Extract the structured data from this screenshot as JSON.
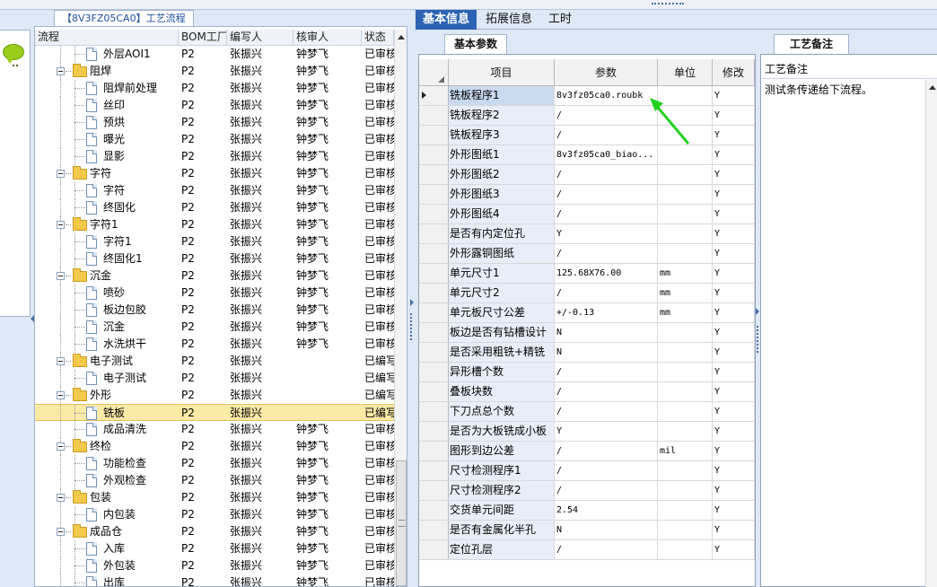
{
  "tree": {
    "tab_title": "【8V3FZ05CA0】工艺流程",
    "columns": [
      "流程",
      "BOM工厂",
      "编写人",
      "核审人",
      "状态"
    ],
    "rows": [
      {
        "label": "外层AOI1",
        "type": "doc",
        "level": 2,
        "bom": "P2",
        "writer": "张振兴",
        "reviewer": "钟梦飞",
        "status": "已审核"
      },
      {
        "label": "阻焊",
        "type": "folder",
        "level": 1,
        "bom": "P2",
        "writer": "张振兴",
        "reviewer": "钟梦飞",
        "status": "已审核"
      },
      {
        "label": "阻焊前处理",
        "type": "doc",
        "level": 2,
        "bom": "P2",
        "writer": "张振兴",
        "reviewer": "钟梦飞",
        "status": "已审核"
      },
      {
        "label": "丝印",
        "type": "doc",
        "level": 2,
        "bom": "P2",
        "writer": "张振兴",
        "reviewer": "钟梦飞",
        "status": "已审核"
      },
      {
        "label": "预烘",
        "type": "doc",
        "level": 2,
        "bom": "P2",
        "writer": "张振兴",
        "reviewer": "钟梦飞",
        "status": "已审核"
      },
      {
        "label": "曝光",
        "type": "doc",
        "level": 2,
        "bom": "P2",
        "writer": "张振兴",
        "reviewer": "钟梦飞",
        "status": "已审核"
      },
      {
        "label": "显影",
        "type": "doc",
        "level": 2,
        "bom": "P2",
        "writer": "张振兴",
        "reviewer": "钟梦飞",
        "status": "已审核"
      },
      {
        "label": "字符",
        "type": "folder",
        "level": 1,
        "bom": "P2",
        "writer": "张振兴",
        "reviewer": "钟梦飞",
        "status": "已审核"
      },
      {
        "label": "字符",
        "type": "doc",
        "level": 2,
        "bom": "P2",
        "writer": "张振兴",
        "reviewer": "钟梦飞",
        "status": "已审核"
      },
      {
        "label": "终固化",
        "type": "doc",
        "level": 2,
        "bom": "P2",
        "writer": "张振兴",
        "reviewer": "钟梦飞",
        "status": "已审核"
      },
      {
        "label": "字符1",
        "type": "folder",
        "level": 1,
        "bom": "P2",
        "writer": "张振兴",
        "reviewer": "钟梦飞",
        "status": "已审核"
      },
      {
        "label": "字符1",
        "type": "doc",
        "level": 2,
        "bom": "P2",
        "writer": "张振兴",
        "reviewer": "钟梦飞",
        "status": "已审核"
      },
      {
        "label": "终固化1",
        "type": "doc",
        "level": 2,
        "bom": "P2",
        "writer": "张振兴",
        "reviewer": "钟梦飞",
        "status": "已审核"
      },
      {
        "label": "沉金",
        "type": "folder",
        "level": 1,
        "bom": "P2",
        "writer": "张振兴",
        "reviewer": "钟梦飞",
        "status": "已审核"
      },
      {
        "label": "喷砂",
        "type": "doc",
        "level": 2,
        "bom": "P2",
        "writer": "张振兴",
        "reviewer": "钟梦飞",
        "status": "已审核"
      },
      {
        "label": "板边包胶",
        "type": "doc",
        "level": 2,
        "bom": "P2",
        "writer": "张振兴",
        "reviewer": "钟梦飞",
        "status": "已审核"
      },
      {
        "label": "沉金",
        "type": "doc",
        "level": 2,
        "bom": "P2",
        "writer": "张振兴",
        "reviewer": "钟梦飞",
        "status": "已审核"
      },
      {
        "label": "水洗烘干",
        "type": "doc",
        "level": 2,
        "bom": "P2",
        "writer": "张振兴",
        "reviewer": "钟梦飞",
        "status": "已审核"
      },
      {
        "label": "电子测试",
        "type": "folder",
        "level": 1,
        "bom": "P2",
        "writer": "张振兴",
        "reviewer": "",
        "status": "已编写"
      },
      {
        "label": "电子测试",
        "type": "doc",
        "level": 2,
        "bom": "P2",
        "writer": "张振兴",
        "reviewer": "",
        "status": "已编写"
      },
      {
        "label": "外形",
        "type": "folder",
        "level": 1,
        "bom": "P2",
        "writer": "张振兴",
        "reviewer": "",
        "status": "已编写"
      },
      {
        "label": "铣板",
        "type": "doc",
        "level": 2,
        "bom": "P2",
        "writer": "张振兴",
        "reviewer": "",
        "status": "已编写",
        "selected": true
      },
      {
        "label": "成品清洗",
        "type": "doc",
        "level": 2,
        "bom": "P2",
        "writer": "张振兴",
        "reviewer": "钟梦飞",
        "status": "已审核"
      },
      {
        "label": "终检",
        "type": "folder",
        "level": 1,
        "bom": "P2",
        "writer": "张振兴",
        "reviewer": "钟梦飞",
        "status": "已审核"
      },
      {
        "label": "功能检查",
        "type": "doc",
        "level": 2,
        "bom": "P2",
        "writer": "张振兴",
        "reviewer": "钟梦飞",
        "status": "已审核"
      },
      {
        "label": "外观检查",
        "type": "doc",
        "level": 2,
        "bom": "P2",
        "writer": "张振兴",
        "reviewer": "钟梦飞",
        "status": "已审核"
      },
      {
        "label": "包装",
        "type": "folder",
        "level": 1,
        "bom": "P2",
        "writer": "张振兴",
        "reviewer": "钟梦飞",
        "status": "已审核"
      },
      {
        "label": "内包装",
        "type": "doc",
        "level": 2,
        "bom": "P2",
        "writer": "张振兴",
        "reviewer": "钟梦飞",
        "status": "已审核"
      },
      {
        "label": "成品仓",
        "type": "folder",
        "level": 1,
        "bom": "P2",
        "writer": "张振兴",
        "reviewer": "钟梦飞",
        "status": "已审核"
      },
      {
        "label": "入库",
        "type": "doc",
        "level": 2,
        "bom": "P2",
        "writer": "张振兴",
        "reviewer": "钟梦飞",
        "status": "已审核"
      },
      {
        "label": "外包装",
        "type": "doc",
        "level": 2,
        "bom": "P2",
        "writer": "张振兴",
        "reviewer": "钟梦飞",
        "status": "已审核"
      },
      {
        "label": "出库",
        "type": "doc",
        "level": 2,
        "bom": "P2",
        "writer": "张振兴",
        "reviewer": "钟梦飞",
        "status": "已审核"
      }
    ]
  },
  "main_tabs": [
    {
      "label": "基本信息",
      "active": true
    },
    {
      "label": "拓展信息",
      "active": false
    },
    {
      "label": "工时",
      "active": false
    }
  ],
  "params": {
    "tab_label": "基本参数",
    "columns": [
      "项目",
      "参数",
      "单位",
      "修改"
    ],
    "rows": [
      {
        "item": "铣板程序1",
        "value": "8v3fz05ca0.roubk",
        "unit": "",
        "mod": "Y",
        "current": true
      },
      {
        "item": "铣板程序2",
        "value": "/",
        "unit": "",
        "mod": "Y"
      },
      {
        "item": "铣板程序3",
        "value": "/",
        "unit": "",
        "mod": "Y"
      },
      {
        "item": "外形图纸1",
        "value": "8v3fz05ca0_biao...",
        "unit": "",
        "mod": "Y"
      },
      {
        "item": "外形图纸2",
        "value": "/",
        "unit": "",
        "mod": "Y"
      },
      {
        "item": "外形图纸3",
        "value": "/",
        "unit": "",
        "mod": "Y"
      },
      {
        "item": "外形图纸4",
        "value": "/",
        "unit": "",
        "mod": "Y"
      },
      {
        "item": "是否有内定位孔",
        "value": "Y",
        "unit": "",
        "mod": "Y"
      },
      {
        "item": "外形露铜图纸",
        "value": "/",
        "unit": "",
        "mod": "Y"
      },
      {
        "item": "单元尺寸1",
        "value": "125.68X76.00",
        "unit": "mm",
        "mod": "Y"
      },
      {
        "item": "单元尺寸2",
        "value": "/",
        "unit": "mm",
        "mod": "Y"
      },
      {
        "item": "单元板尺寸公差",
        "value": "+/-0.13",
        "unit": "mm",
        "mod": "Y"
      },
      {
        "item": "板边是否有钻槽设计",
        "value": "N",
        "unit": "",
        "mod": "Y"
      },
      {
        "item": "是否采用粗铣+精铣",
        "value": "N",
        "unit": "",
        "mod": "Y"
      },
      {
        "item": "异形槽个数",
        "value": "/",
        "unit": "",
        "mod": "Y"
      },
      {
        "item": "叠板块数",
        "value": "/",
        "unit": "",
        "mod": "Y"
      },
      {
        "item": "下刀点总个数",
        "value": "/",
        "unit": "",
        "mod": "Y"
      },
      {
        "item": "是否为大板铣成小板",
        "value": "Y",
        "unit": "",
        "mod": "Y"
      },
      {
        "item": "图形到边公差",
        "value": "/",
        "unit": "mil",
        "mod": "Y"
      },
      {
        "item": "尺寸检测程序1",
        "value": "/",
        "unit": "",
        "mod": "Y"
      },
      {
        "item": "尺寸检测程序2",
        "value": "/",
        "unit": "",
        "mod": "Y"
      },
      {
        "item": "交货单元间距",
        "value": "2.54",
        "unit": "",
        "mod": "Y"
      },
      {
        "item": "是否有金属化半孔",
        "value": "N",
        "unit": "",
        "mod": "Y"
      },
      {
        "item": "定位孔层",
        "value": "/",
        "unit": "",
        "mod": "Y"
      }
    ]
  },
  "remarks": {
    "tab_label": "工艺备注",
    "header": "工艺备注",
    "text": "测试条传递给下流程。"
  },
  "colors": {
    "accent_tab": "#2d63b3",
    "selection": "#fbe9a6",
    "annotation_arrow": "#21d021"
  }
}
